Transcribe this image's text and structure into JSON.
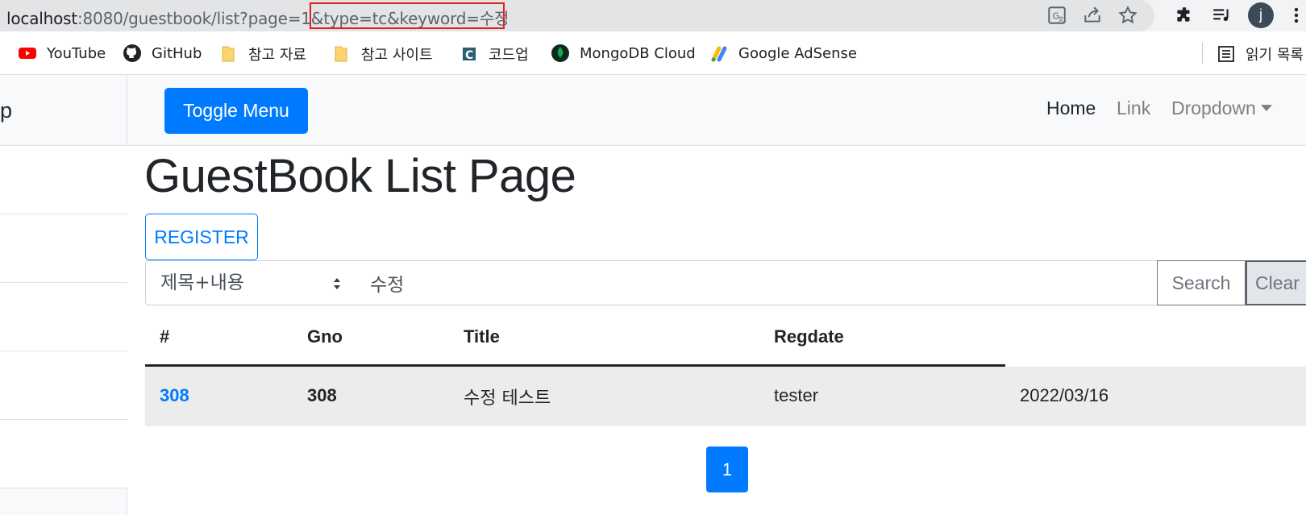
{
  "browser": {
    "url_host": "localhost",
    "url_rest": ":8080/guestbook/list?page=1&",
    "url_highlighted": "type=tc&keyword=수정",
    "profile_initial": "j"
  },
  "bookmarks": [
    {
      "label": "YouTube",
      "icon": "youtube-icon"
    },
    {
      "label": "GitHub",
      "icon": "github-icon"
    },
    {
      "label": "참고 자료",
      "icon": "folder-icon"
    },
    {
      "label": "참고 사이트",
      "icon": "folder-icon"
    },
    {
      "label": "코드업",
      "icon": "codeup-icon"
    },
    {
      "label": "MongoDB Cloud",
      "icon": "mongodb-icon"
    },
    {
      "label": "Google AdSense",
      "icon": "adsense-icon"
    }
  ],
  "reading_list": {
    "label": "읽기 목록",
    "icon": "reading-list-icon"
  },
  "sidebar": {
    "heading": "p"
  },
  "navbar": {
    "toggle_label": "Toggle Menu",
    "links": {
      "home": "Home",
      "link": "Link",
      "dropdown": "Dropdown"
    }
  },
  "page": {
    "title": "GuestBook List Page",
    "register_label": "REGISTER"
  },
  "search": {
    "type_selected": "제목+내용",
    "keyword": "수정",
    "search_label": "Search",
    "clear_label": "Clear"
  },
  "table": {
    "headers": {
      "num": "#",
      "gno": "Gno",
      "title": "Title",
      "regdate": "Regdate"
    },
    "rows": [
      {
        "num": "308",
        "gno": "308",
        "title": "수정 테스트",
        "writer": "tester",
        "regdate": "2022/03/16"
      }
    ]
  },
  "pagination": {
    "current": "1"
  },
  "colors": {
    "primary": "#007bff",
    "highlight": "#e02020"
  }
}
